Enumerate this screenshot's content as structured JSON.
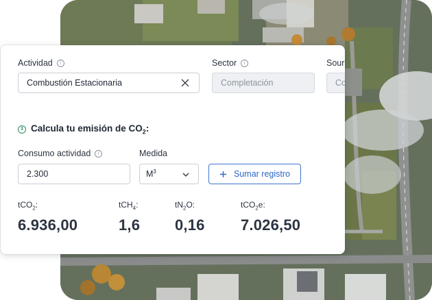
{
  "form": {
    "actividad": {
      "label": "Actividad",
      "value": "Combustión Estacionaria"
    },
    "sector": {
      "label": "Sector",
      "value": "Completación"
    },
    "source": {
      "label": "Source",
      "value": "Combustión"
    }
  },
  "calc": {
    "title_prefix": "Calcula tu emisión de CO",
    "title_sub": "2",
    "title_suffix": ":",
    "step": "3",
    "consumo": {
      "label": "Consumo actividad",
      "value": "2.300"
    },
    "medida": {
      "label": "Medida",
      "value_base": "M",
      "value_sup": "3"
    },
    "add_button": "Sumar registro"
  },
  "metrics": [
    {
      "pre": "tCO",
      "sub": "2",
      "post": ":",
      "value": "6.936,00"
    },
    {
      "pre": "tCH",
      "sub": "4",
      "post": ":",
      "value": "1,6"
    },
    {
      "pre": "tN",
      "sub": "2",
      "mid": "O",
      "post": ":",
      "value": "0,16"
    },
    {
      "pre": "tCO",
      "sub": "2",
      "mid": "e",
      "post": ":",
      "value": "7.026,50"
    }
  ],
  "colors": {
    "accent": "#2f66c8",
    "step": "#2d8a5f"
  }
}
